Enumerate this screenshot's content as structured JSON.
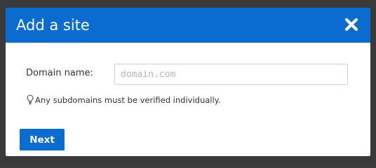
{
  "dialog": {
    "title": "Add a site",
    "close_icon": "close-icon",
    "header_color": "#0a6ccf"
  },
  "form": {
    "domain_label": "Domain name:",
    "domain_value": "",
    "domain_placeholder": "domain.com",
    "hint_icon": "lightbulb-icon",
    "hint_text": "Any subdomains must be verified individually."
  },
  "actions": {
    "next_label": "Next",
    "accent_color": "#0a6ccf"
  }
}
